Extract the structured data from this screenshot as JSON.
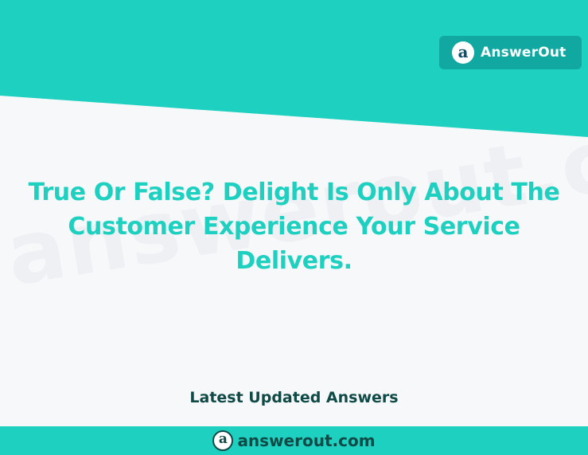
{
  "brand": {
    "name": "AnswerOut",
    "logo_letter": "a"
  },
  "watermark": "answerout.com",
  "question": {
    "title": "True Or False? Delight Is Only About The Customer Experience Your Service Delivers."
  },
  "latest_label": "Latest Updated Answers",
  "footer": {
    "logo_letter": "a",
    "domain": "answerout.com"
  },
  "colors": {
    "teal": "#1ed0c0",
    "badge": "#10a8a0",
    "dark": "#0f4a47",
    "background": "#f7f8fa"
  }
}
